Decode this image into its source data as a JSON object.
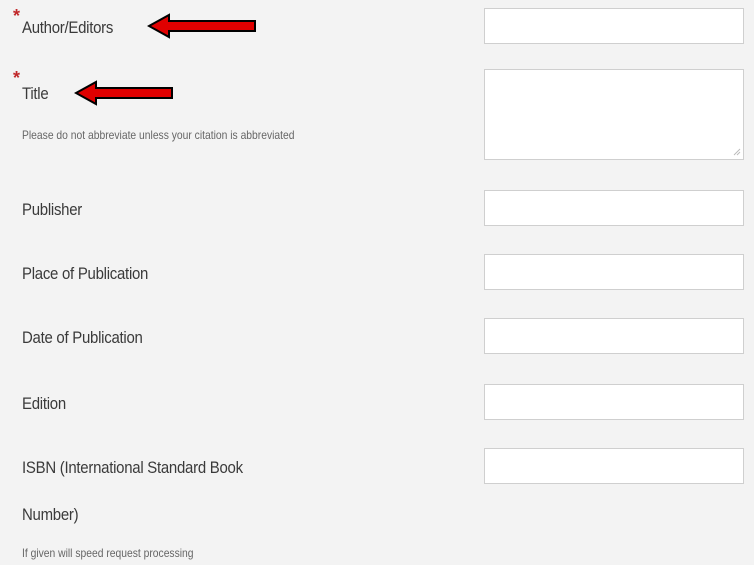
{
  "form": {
    "fields": {
      "author": {
        "required_mark": "*",
        "label": "Author/Editors",
        "value": ""
      },
      "title": {
        "required_mark": "*",
        "label": "Title",
        "hint": "Please do not abbreviate unless your citation is abbreviated",
        "value": ""
      },
      "publisher": {
        "label": "Publisher",
        "value": ""
      },
      "place": {
        "label": "Place of Publication",
        "value": ""
      },
      "date": {
        "label": "Date of Publication",
        "value": ""
      },
      "edition": {
        "label": "Edition",
        "value": ""
      },
      "isbn": {
        "label_line1": "ISBN (International Standard Book",
        "label_line2": "Number)",
        "hint": "If given will speed request processing",
        "value": ""
      }
    }
  },
  "annotations": {
    "arrow_color": "#e00000",
    "arrow_outline": "#000000",
    "arrow_icon": "red-left-arrow-icon"
  }
}
